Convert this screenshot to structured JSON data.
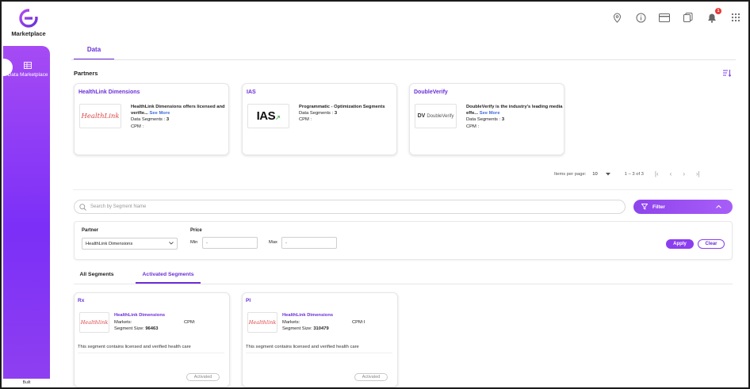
{
  "app": {
    "name": "Marketplace"
  },
  "topbar": {
    "icons": [
      "location-pin-icon",
      "info-icon",
      "card-icon",
      "copy-icon",
      "bell-icon",
      "apps-grid-icon"
    ],
    "notification_count": "1"
  },
  "sidebar": {
    "items": [
      {
        "label": "Data Marketplace",
        "icon": "table-grid-icon"
      }
    ],
    "bottom_text": "Built"
  },
  "tabs": {
    "main": "Data"
  },
  "partners": {
    "title": "Partners",
    "cards": [
      {
        "name": "HealthLink Dimensions",
        "logo_text": "HealthLink",
        "description": "HealthLink Dimensions offers licensed and verifie...",
        "see_more": "See More",
        "segments_label": "Data Segments :",
        "segments_value": "3",
        "cpm_label": "CPM :",
        "cpm_value": ""
      },
      {
        "name": "IAS",
        "logo_text": "IAS",
        "description": "Programmatic - Optimization Segments",
        "see_more": "",
        "segments_label": "Data Segments :",
        "segments_value": "3",
        "cpm_label": "CPM :",
        "cpm_value": ""
      },
      {
        "name": "DoubleVerify",
        "logo_text": "DV",
        "logo_subtext": "DoubleVerify",
        "description": "DoubleVerify is the industry's leading media effe...",
        "see_more": "See More",
        "segments_label": "Data Segments :",
        "segments_value": "3",
        "cpm_label": "CPM :",
        "cpm_value": ""
      }
    ]
  },
  "paginator": {
    "items_per_page_label": "Items per page:",
    "items_per_page": "10",
    "range": "1 – 3 of 3"
  },
  "search": {
    "placeholder": "Search by Segment Name"
  },
  "filter": {
    "button_label": "Filter",
    "partner_label": "Partner",
    "partner_value": "HealthLink Dimensions",
    "price_label": "Price",
    "min_label": "Min",
    "min_value": "-",
    "max_label": "Max",
    "max_value": "-",
    "apply_label": "Apply",
    "clear_label": "Clear"
  },
  "segment_tabs": [
    {
      "label": "All Segments",
      "active": false
    },
    {
      "label": "Activated Segments",
      "active": true
    }
  ],
  "segments": [
    {
      "title": "Rx",
      "partner": "HealthLink Dimensions",
      "markets_label": "Markets:",
      "cpm_label": "CPM:",
      "cpm_value": "",
      "size_label": "Segment Size:",
      "size_value": "96463",
      "description": "This segment contains licensed and verified health care",
      "status": "Activated"
    },
    {
      "title": "PI",
      "partner": "HealthLink Dimensions",
      "markets_label": "Markets:",
      "cpm_label": "CPM:",
      "cpm_value": "I",
      "size_label": "Segment Size:",
      "size_value": "310479",
      "description": "This segment contains licensed and verified health care",
      "status": "Activated"
    }
  ],
  "colors": {
    "accent": "#6a2fd8",
    "sidebar": "#8b3df0",
    "link": "#3d6be0"
  }
}
